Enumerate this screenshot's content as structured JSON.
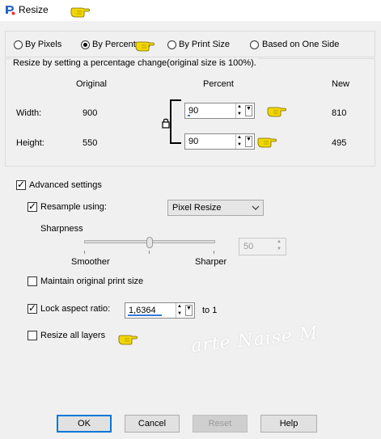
{
  "window": {
    "title": "Resize"
  },
  "mode": {
    "options": [
      {
        "label": "By Pixels",
        "selected": false
      },
      {
        "label": "By Percentage",
        "selected": true
      },
      {
        "label": "By Print Size",
        "selected": false
      },
      {
        "label": "Based on One Side",
        "selected": false
      }
    ]
  },
  "percent_group": {
    "legend": "Resize by setting a percentage change(original size is 100%).",
    "col_original": "Original",
    "col_percent": "Percent",
    "col_new": "New",
    "width": {
      "label": "Width:",
      "original": "900",
      "percent": "90",
      "new": "810"
    },
    "height": {
      "label": "Height:",
      "original": "550",
      "percent": "90",
      "new": "495"
    }
  },
  "advanced": {
    "label": "Advanced settings",
    "checked": true,
    "resample": {
      "label": "Resample using:",
      "checked": true,
      "value": "Pixel Resize"
    },
    "sharpness": {
      "label": "Sharpness",
      "min_label": "Smoother",
      "max_label": "Sharper",
      "value": "50",
      "level": 0.5
    },
    "maintain_print_size": {
      "label": "Maintain original print size",
      "checked": false
    },
    "lock_aspect": {
      "label": "Lock aspect ratio:",
      "checked": true,
      "value": "1,6364",
      "suffix": "to 1"
    },
    "resize_all_layers": {
      "label": "Resize all layers",
      "checked": false
    }
  },
  "watermark": "arte Naise M",
  "buttons": {
    "ok": "OK",
    "cancel": "Cancel",
    "reset": "Reset",
    "help": "Help"
  },
  "colors": {
    "pointer_hand": "#f2d600",
    "accent_blue": "#0078d7"
  }
}
